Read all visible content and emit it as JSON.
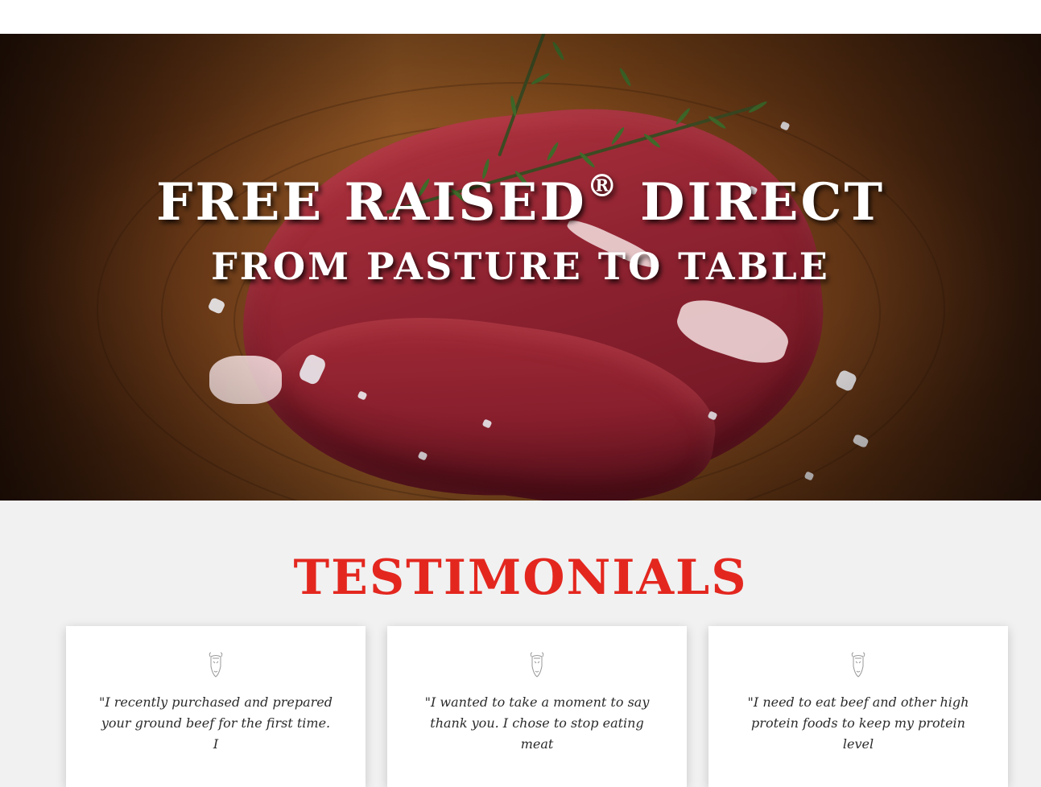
{
  "hero": {
    "title": "FREE RAISED",
    "trademark": "®",
    "title_end": " DIRECT",
    "subtitle": "FROM PASTURE TO TABLE"
  },
  "testimonials": {
    "heading": "TESTIMONIALS",
    "cards": [
      {
        "icon": "bull-head-icon",
        "quote": "\"I recently purchased and prepared your ground beef for the first time. I"
      },
      {
        "icon": "bull-head-icon",
        "quote": "\"I wanted to take a moment to say thank you. I chose to stop eating meat"
      },
      {
        "icon": "bull-head-icon",
        "quote": "\"I need to eat beef and other high protein foods to keep my protein level"
      }
    ]
  },
  "colors": {
    "accent": "#e3271f",
    "page_background": "#f1f1f1",
    "card_background": "#ffffff"
  }
}
